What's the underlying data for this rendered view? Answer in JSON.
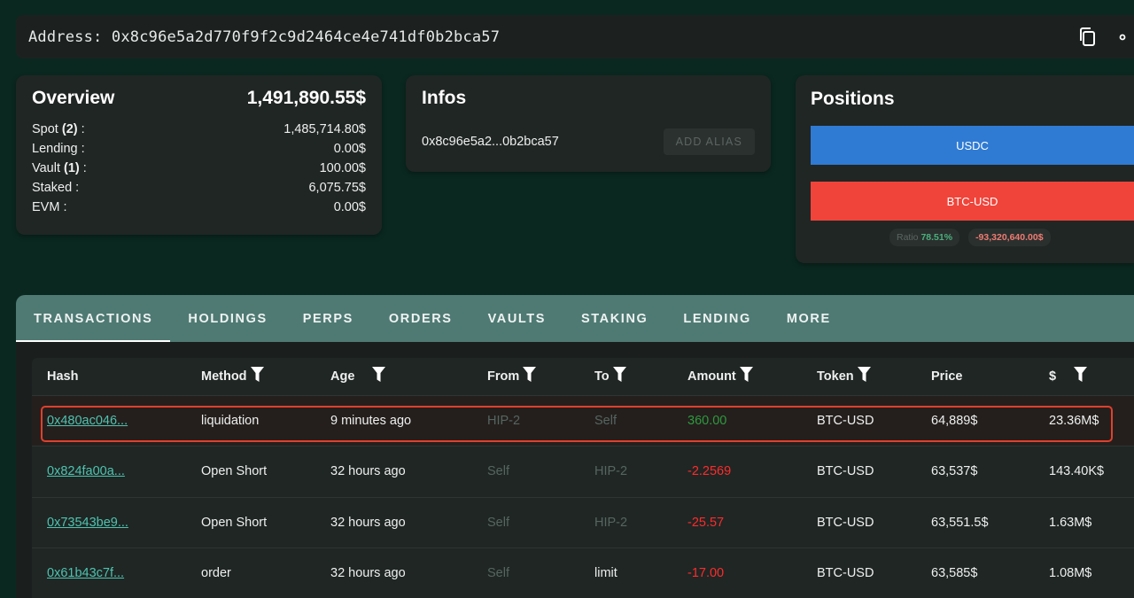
{
  "address_bar": {
    "text": "Address: 0x8c96e5a2d770f9f2c9d2464ce4e741df0b2bca57",
    "icons": [
      "copy-icon",
      "share-icon"
    ]
  },
  "overview": {
    "title": "Overview",
    "total": "1,491,890.55$",
    "rows": [
      {
        "label": "Spot ",
        "count": "(2)",
        "suffix": " :",
        "value": "1,485,714.80$"
      },
      {
        "label": "Lending :",
        "count": "",
        "suffix": "",
        "value": "0.00$"
      },
      {
        "label": "Vault ",
        "count": "(1)",
        "suffix": " :",
        "value": "100.00$"
      },
      {
        "label": "Staked :",
        "count": "",
        "suffix": "",
        "value": "6,075.75$"
      },
      {
        "label": "EVM :",
        "count": "",
        "suffix": "",
        "value": "0.00$"
      }
    ]
  },
  "infos": {
    "title": "Infos",
    "short_address": "0x8c96e5a2...0b2bca57",
    "add_alias_label": "ADD ALIAS"
  },
  "positions": {
    "title": "Positions",
    "usdc_label": "USDC",
    "btc_label": "BTC-USD",
    "ratio_label": "Ratio",
    "ratio_value": "78.51%",
    "pnl": "-93,320,640.00$",
    "colors": {
      "usdc": "#2f7bd4",
      "btc": "#f0443a"
    }
  },
  "tabs": [
    "TRANSACTIONS",
    "HOLDINGS",
    "PERPS",
    "ORDERS",
    "VAULTS",
    "STAKING",
    "LENDING",
    "MORE"
  ],
  "active_tab": "TRANSACTIONS",
  "table": {
    "headers": [
      "Hash",
      "Method",
      "Age",
      "From",
      "To",
      "Amount",
      "Token",
      "Price",
      "$"
    ],
    "rows": [
      {
        "hash": "0x480ac046...",
        "method": "liquidation",
        "age": "9 minutes ago",
        "from": "HIP-2",
        "to": "Self",
        "amount": "360.00",
        "token": "BTC-USD",
        "price": "64,889$",
        "usd": "23.36M$"
      },
      {
        "hash": "0x824fa00a...",
        "method": "Open Short",
        "age": "32 hours ago",
        "from": "Self",
        "to": "HIP-2",
        "amount": "-2.2569",
        "token": "BTC-USD",
        "price": "63,537$",
        "usd": "143.40K$"
      },
      {
        "hash": "0x73543be9...",
        "method": "Open Short",
        "age": "32 hours ago",
        "from": "Self",
        "to": "HIP-2",
        "amount": "-25.57",
        "token": "BTC-USD",
        "price": "63,551.5$",
        "usd": "1.63M$"
      },
      {
        "hash": "0x61b43c7f...",
        "method": "order",
        "age": "32 hours ago",
        "from": "Self",
        "to": "limit",
        "amount": "-17.00",
        "token": "BTC-USD",
        "price": "63,585$",
        "usd": "1.08M$"
      }
    ]
  }
}
